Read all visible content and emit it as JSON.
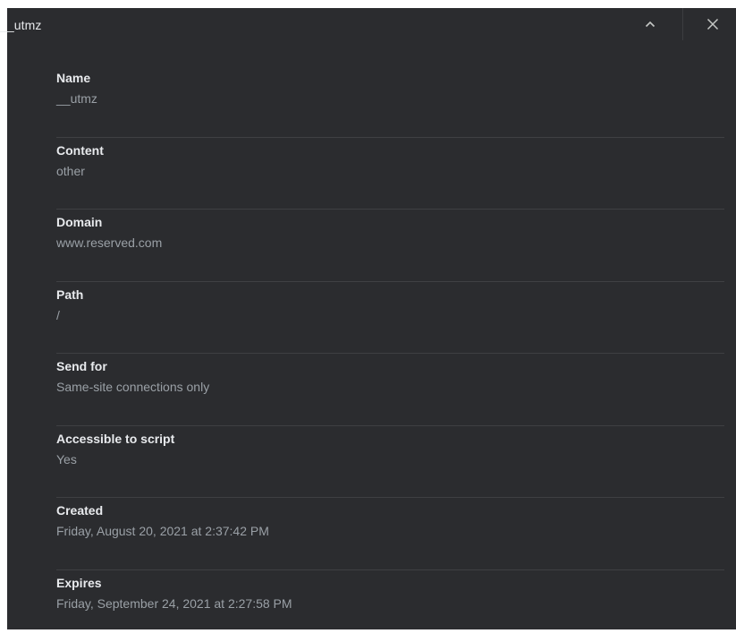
{
  "header": {
    "title": "__utmz",
    "collapse_icon": "chevron-up-icon",
    "close_icon": "close-icon"
  },
  "fields": [
    {
      "label": "Name",
      "value": "__utmz"
    },
    {
      "label": "Content",
      "value": "other"
    },
    {
      "label": "Domain",
      "value": "www.reserved.com"
    },
    {
      "label": "Path",
      "value": "/"
    },
    {
      "label": "Send for",
      "value": "Same-site connections only"
    },
    {
      "label": "Accessible to script",
      "value": "Yes"
    },
    {
      "label": "Created",
      "value": "Friday, August 20, 2021 at 2:37:42 PM"
    },
    {
      "label": "Expires",
      "value": "Friday, September 24, 2021 at 2:27:58 PM"
    }
  ],
  "colors": {
    "panel_background": "#2b2c2f",
    "label_text": "#e8eaed",
    "value_text": "#9aa0a6",
    "divider": "#3f4043"
  }
}
